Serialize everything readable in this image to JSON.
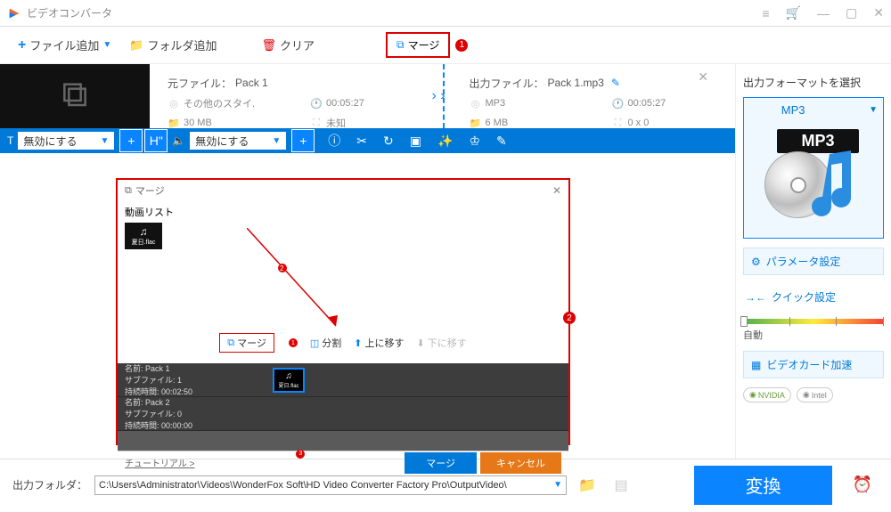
{
  "title": "ビデオコンバータ",
  "toolbar": {
    "add_file": "ファイル追加",
    "add_folder": "フォルダ追加",
    "clear": "クリア",
    "merge": "マージ"
  },
  "file_info": {
    "source_label": "元ファイル：",
    "source_name": "Pack 1",
    "output_label": "出力ファイル：",
    "output_name": "Pack 1.mp3",
    "source_style": "その他のスタイ.",
    "source_duration": "00:05:27",
    "source_size": "30 MB",
    "source_res": "未知",
    "output_format": "MP3",
    "output_duration": "00:05:27",
    "output_size": "6 MB",
    "output_res": "0 x 0"
  },
  "actionbar": {
    "disable1": "無効にする",
    "disable2": "無効にする"
  },
  "merge_dialog": {
    "title": "マージ",
    "video_list": "動画リスト",
    "thumb_label": "夏日.flac",
    "merge": "マージ",
    "split": "分割",
    "move_up": "上に移す",
    "move_down": "下に移す",
    "pack1_name": "名前: Pack 1",
    "pack1_sub": "サブファイル: 1",
    "pack1_time": "持続時間: 00:02:50",
    "pack2_name": "名前: Pack 2",
    "pack2_sub": "サブファイル: 0",
    "pack2_time": "持続時間: 00:00:00",
    "tutorial": "チュートリアル >",
    "merge_btn": "マージ",
    "cancel_btn": "キャンセル"
  },
  "right_panel": {
    "title": "出力フォーマットを選択",
    "format": "MP3",
    "param_settings": "パラメータ設定",
    "quick_settings": "クイック設定",
    "auto": "自動",
    "gpu_accel": "ビデオカード加速",
    "nvidia": "NVIDIA",
    "intel": "Intel"
  },
  "bottom": {
    "label": "出力フォルダ：",
    "path": "C:\\Users\\Administrator\\Videos\\WonderFox Soft\\HD Video Converter Factory Pro\\OutputVideo\\",
    "convert": "変換"
  },
  "badges": {
    "b1": "1",
    "b2": "2",
    "b3": "3"
  }
}
